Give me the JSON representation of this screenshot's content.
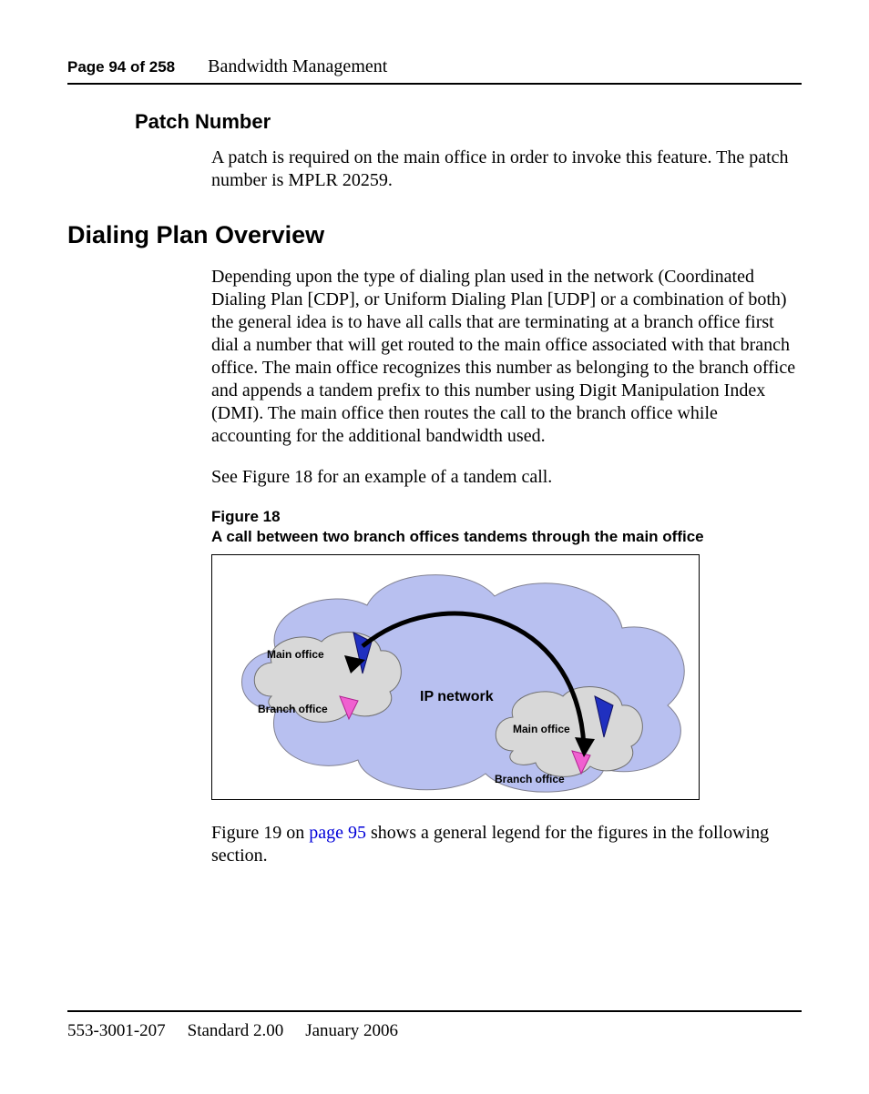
{
  "header": {
    "page_label": "Page 94 of 258",
    "section": "Bandwidth Management"
  },
  "patch": {
    "heading": "Patch Number",
    "body": "A patch is required on the main office in order to invoke this feature. The patch number is MPLR 20259."
  },
  "overview": {
    "heading": "Dialing Plan Overview",
    "body": "Depending upon the type of dialing plan used in the network (Coordinated Dialing Plan [CDP], or Uniform Dialing Plan [UDP] or a combination of both) the general idea is to have all calls that are terminating at a branch office first dial a number that will get routed to the main office associated with that branch office. The main office recognizes this number as belonging to the branch office and appends a tandem prefix to this number using Digit Manipulation Index (DMI). The main office then routes the call to the branch office while accounting for the additional bandwidth used.",
    "see_figure": "See Figure 18 for an example of a tandem call."
  },
  "figure": {
    "label": "Figure 18",
    "caption": "A call between two branch offices tandems through the main office",
    "labels": {
      "ip_network": "IP network",
      "main_office_left": "Main office",
      "branch_office_left": "Branch office",
      "main_office_right": "Main office",
      "branch_office_right": "Branch office"
    }
  },
  "after_figure": {
    "pre": "Figure 19 on ",
    "link": "page 95",
    "post": " shows a general legend for the figures in the following section."
  },
  "footer": {
    "docnum": "553-3001-207",
    "standard": "Standard 2.00",
    "date": "January 2006"
  }
}
